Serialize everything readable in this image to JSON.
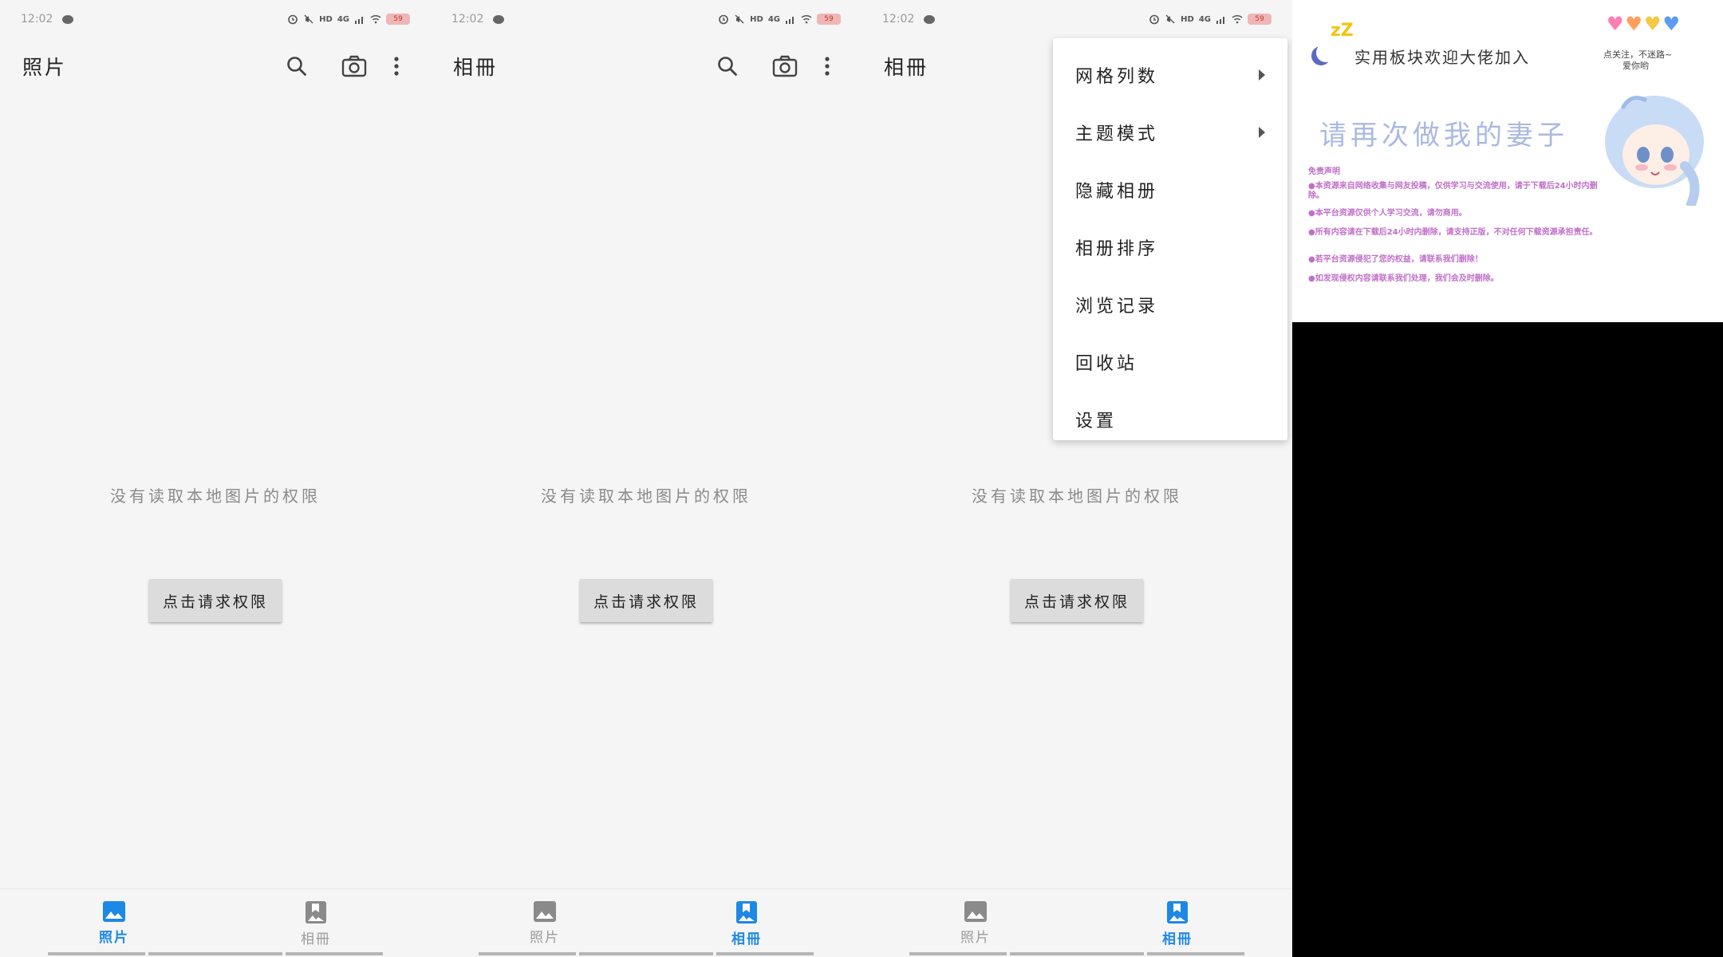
{
  "status": {
    "time": "12:02",
    "net": "4G",
    "hd": "HD",
    "battery": "59"
  },
  "screens": [
    {
      "title": "照片",
      "show_actions": true
    },
    {
      "title": "相冊",
      "show_actions": true
    },
    {
      "title": "相冊",
      "show_actions": false
    }
  ],
  "empty_message": "没有读取本地图片的权限",
  "permission_button": "点击请求权限",
  "nav": {
    "photos": "照片",
    "albums": "相冊"
  },
  "active_tab": [
    "photos",
    "albums",
    "albums"
  ],
  "menu": {
    "items": [
      {
        "label": "网格列数",
        "submenu": true
      },
      {
        "label": "主题模式",
        "submenu": true
      },
      {
        "label": "隐藏相册",
        "submenu": false
      },
      {
        "label": "相册排序",
        "submenu": false
      },
      {
        "label": "浏览记录",
        "submenu": false
      },
      {
        "label": "回收站",
        "submenu": false
      },
      {
        "label": "设置",
        "submenu": false
      }
    ]
  },
  "banner": {
    "zz": "zZ",
    "headline": "实用板块欢迎大佬加入",
    "note_line1": "点关注，不迷路~",
    "note_line2": "爱你哟",
    "bigline": "请再次做我的妻子",
    "disclaimer_title": "免责声明",
    "disclaimer": [
      "●本资源来自网络收集与网友投稿，仅供学习与交流使用，请于下载后24小时内删除。",
      "●本平台资源仅供个人学习交流，请勿商用。",
      "●所有内容请在下载后24小时内删除，请支持正版，不对任何下载资源承担责任。",
      "●若平台资源侵犯了您的权益，请联系我们删除！",
      "●如发现侵权内容请联系我们处理，我们会及时删除。"
    ],
    "colors": {
      "disclaimer": "#c06fc9",
      "bigline": "#aab9e0"
    }
  },
  "colors": {
    "accent": "#1e88e5",
    "inactive": "#9a9a9a",
    "background": "#f5f5f5"
  }
}
